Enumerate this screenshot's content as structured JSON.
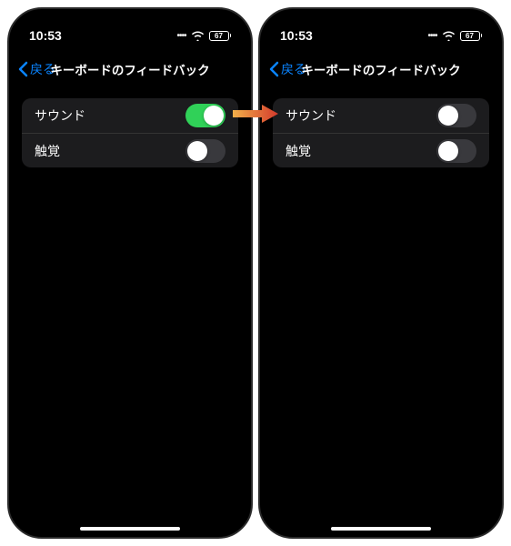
{
  "status": {
    "time": "10:53",
    "battery_level": "67"
  },
  "nav": {
    "back_label": "戻る",
    "title": "キーボードのフィードバック"
  },
  "settings": {
    "sound_label": "サウンド",
    "haptic_label": "触覚"
  },
  "left_panel": {
    "sound_on": true,
    "haptic_on": false
  },
  "right_panel": {
    "sound_on": false,
    "haptic_on": false
  },
  "colors": {
    "accent_blue": "#0a84ff",
    "toggle_on": "#30d158",
    "toggle_off": "#39393d",
    "arrow_fill": "#d33a2c"
  }
}
